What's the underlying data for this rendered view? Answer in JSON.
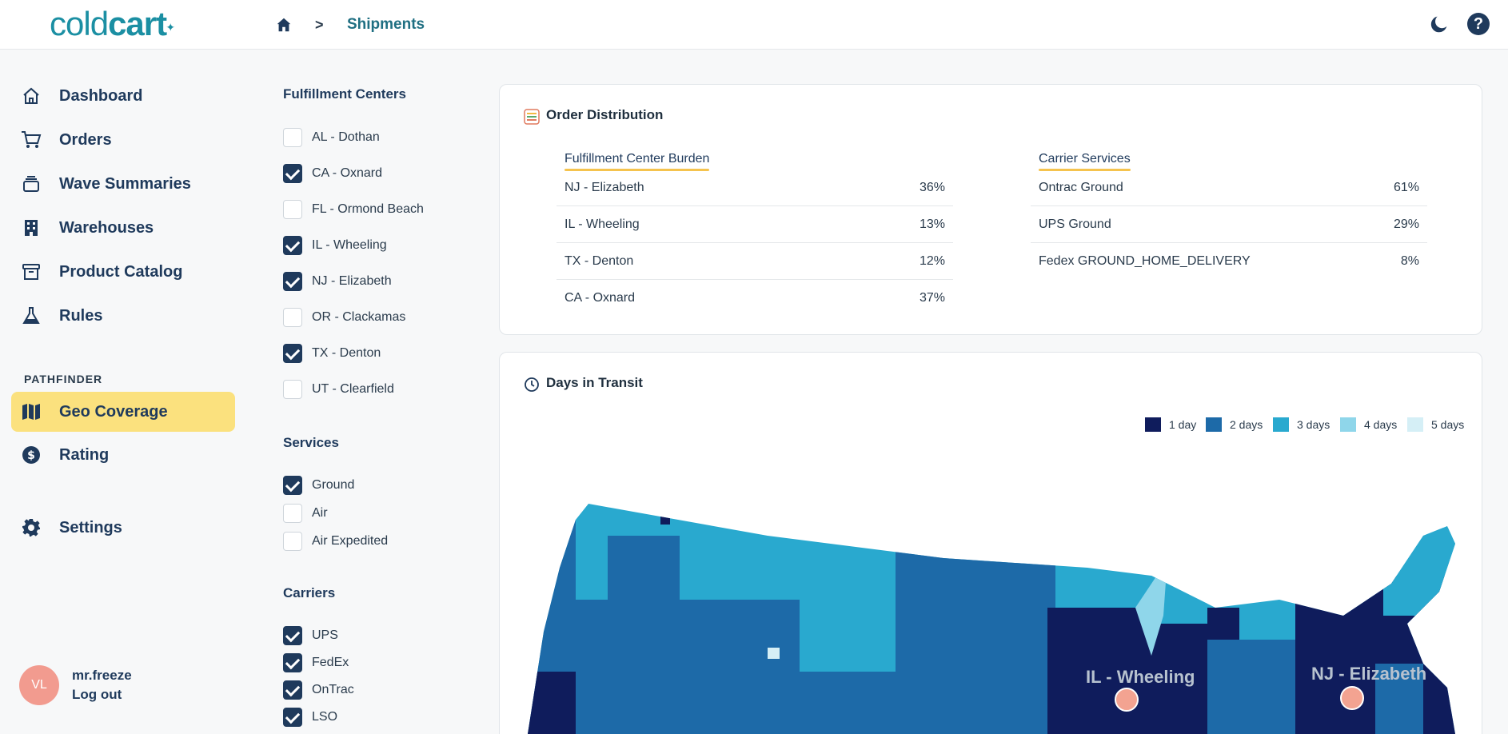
{
  "app": {
    "logo_part1": "cold",
    "logo_part2": "cart"
  },
  "breadcrumb": {
    "separator": ">",
    "current": "Shipments"
  },
  "sidebar": {
    "items": [
      {
        "label": "Dashboard",
        "icon": "home-icon"
      },
      {
        "label": "Orders",
        "icon": "cart-icon"
      },
      {
        "label": "Wave Summaries",
        "icon": "layers-icon"
      },
      {
        "label": "Warehouses",
        "icon": "building-icon"
      },
      {
        "label": "Product Catalog",
        "icon": "archive-icon"
      },
      {
        "label": "Rules",
        "icon": "flask-icon"
      }
    ],
    "section_label": "PATHFINDER",
    "pathfinder_items": [
      {
        "label": "Geo Coverage",
        "icon": "map-icon",
        "active": true
      },
      {
        "label": "Rating",
        "icon": "dollar-icon",
        "active": false
      }
    ],
    "settings_label": "Settings",
    "user": {
      "initials": "VL",
      "name": "mr.freeze",
      "logout": "Log out"
    }
  },
  "filters": {
    "fulfillment_title": "Fulfillment Centers",
    "fulfillment": [
      {
        "label": "AL - Dothan",
        "checked": false
      },
      {
        "label": "CA - Oxnard",
        "checked": true
      },
      {
        "label": "FL - Ormond Beach",
        "checked": false
      },
      {
        "label": "IL - Wheeling",
        "checked": true
      },
      {
        "label": "NJ - Elizabeth",
        "checked": true
      },
      {
        "label": "OR - Clackamas",
        "checked": false
      },
      {
        "label": "TX - Denton",
        "checked": true
      },
      {
        "label": "UT - Clearfield",
        "checked": false
      }
    ],
    "services_title": "Services",
    "services": [
      {
        "label": "Ground",
        "checked": true
      },
      {
        "label": "Air",
        "checked": false
      },
      {
        "label": "Air Expedited",
        "checked": false
      }
    ],
    "carriers_title": "Carriers",
    "carriers": [
      {
        "label": "UPS",
        "checked": true
      },
      {
        "label": "FedEx",
        "checked": true
      },
      {
        "label": "OnTrac",
        "checked": true
      },
      {
        "label": "LSO",
        "checked": true
      }
    ]
  },
  "order_distribution": {
    "title": "Order Distribution",
    "burden_title": "Fulfillment Center Burden",
    "burden": [
      {
        "name": "NJ - Elizabeth",
        "value": "36%"
      },
      {
        "name": "IL - Wheeling",
        "value": "13%"
      },
      {
        "name": "TX - Denton",
        "value": "12%"
      },
      {
        "name": "CA - Oxnard",
        "value": "37%"
      }
    ],
    "carrier_title": "Carrier Services",
    "carriers": [
      {
        "name": "Ontrac Ground",
        "value": "61%"
      },
      {
        "name": "UPS Ground",
        "value": "29%"
      },
      {
        "name": "Fedex GROUND_HOME_DELIVERY",
        "value": "8%"
      }
    ]
  },
  "transit": {
    "title": "Days in Transit",
    "legend": [
      {
        "label": "1 day",
        "color": "#0f1c5c"
      },
      {
        "label": "2 days",
        "color": "#1d6aa8"
      },
      {
        "label": "3 days",
        "color": "#29a9cf"
      },
      {
        "label": "4 days",
        "color": "#8fd6ea"
      },
      {
        "label": "5 days",
        "color": "#d5eff6"
      }
    ],
    "cities": [
      {
        "label": "IL - Wheeling"
      },
      {
        "label": "NJ - Elizabeth"
      }
    ]
  }
}
